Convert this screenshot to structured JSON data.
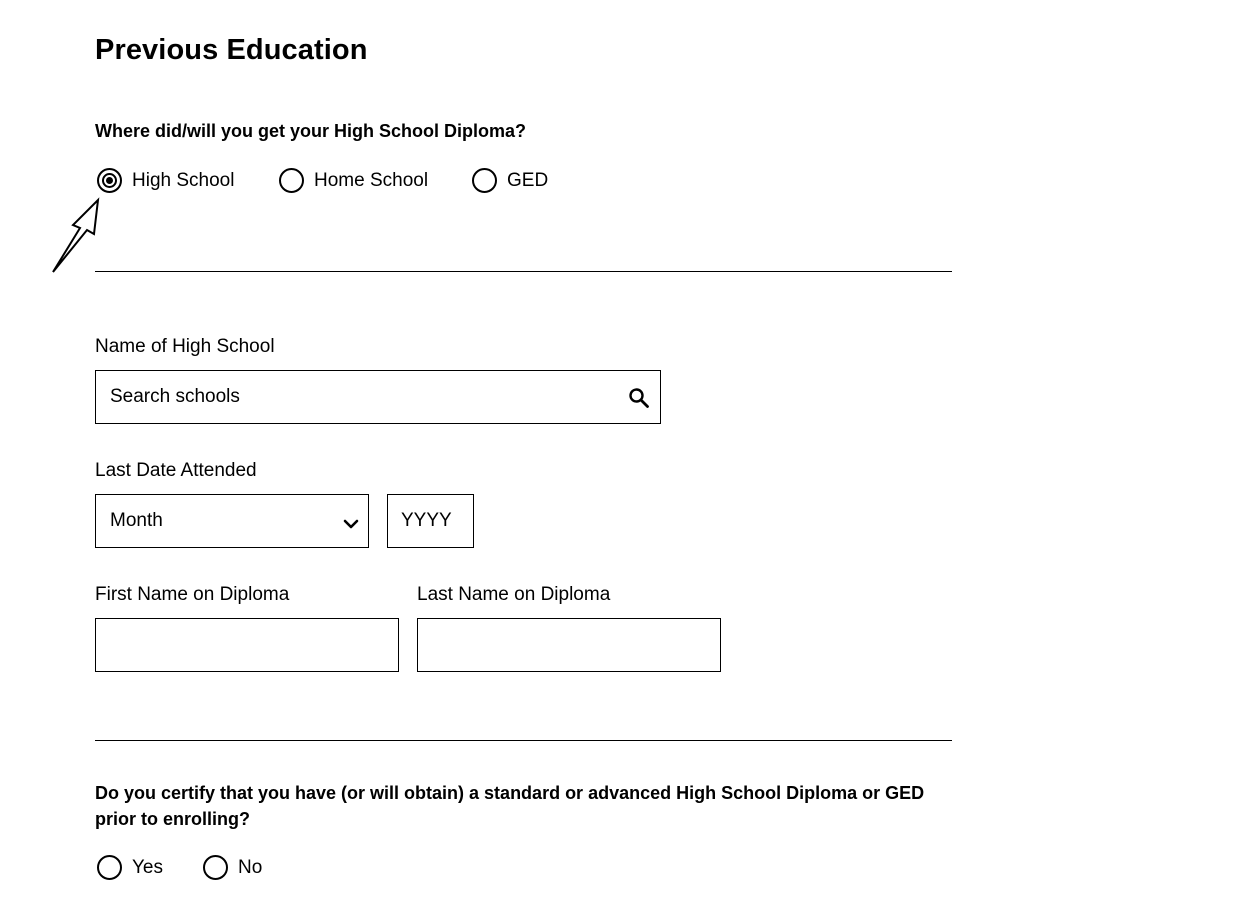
{
  "page": {
    "title": "Previous Education"
  },
  "diploma_question": {
    "label": "Where did/will you get your High School Diploma?",
    "options": [
      "High School",
      "Home School",
      "GED"
    ],
    "selected": "High School"
  },
  "school": {
    "label": "Name of High School",
    "placeholder": "Search schools",
    "icon": "search-icon"
  },
  "last_date": {
    "label": "Last Date Attended",
    "month_value": "Month",
    "year_placeholder": "YYYY"
  },
  "diploma_names": {
    "first_label": "First Name on Diploma",
    "first_value": "",
    "last_label": "Last Name on Diploma",
    "last_value": ""
  },
  "certify_question": {
    "label": "Do you certify that you have (or will obtain) a standard or advanced High School Diploma or GED prior to enrolling?",
    "options": [
      "Yes",
      "No"
    ],
    "selected": ""
  }
}
